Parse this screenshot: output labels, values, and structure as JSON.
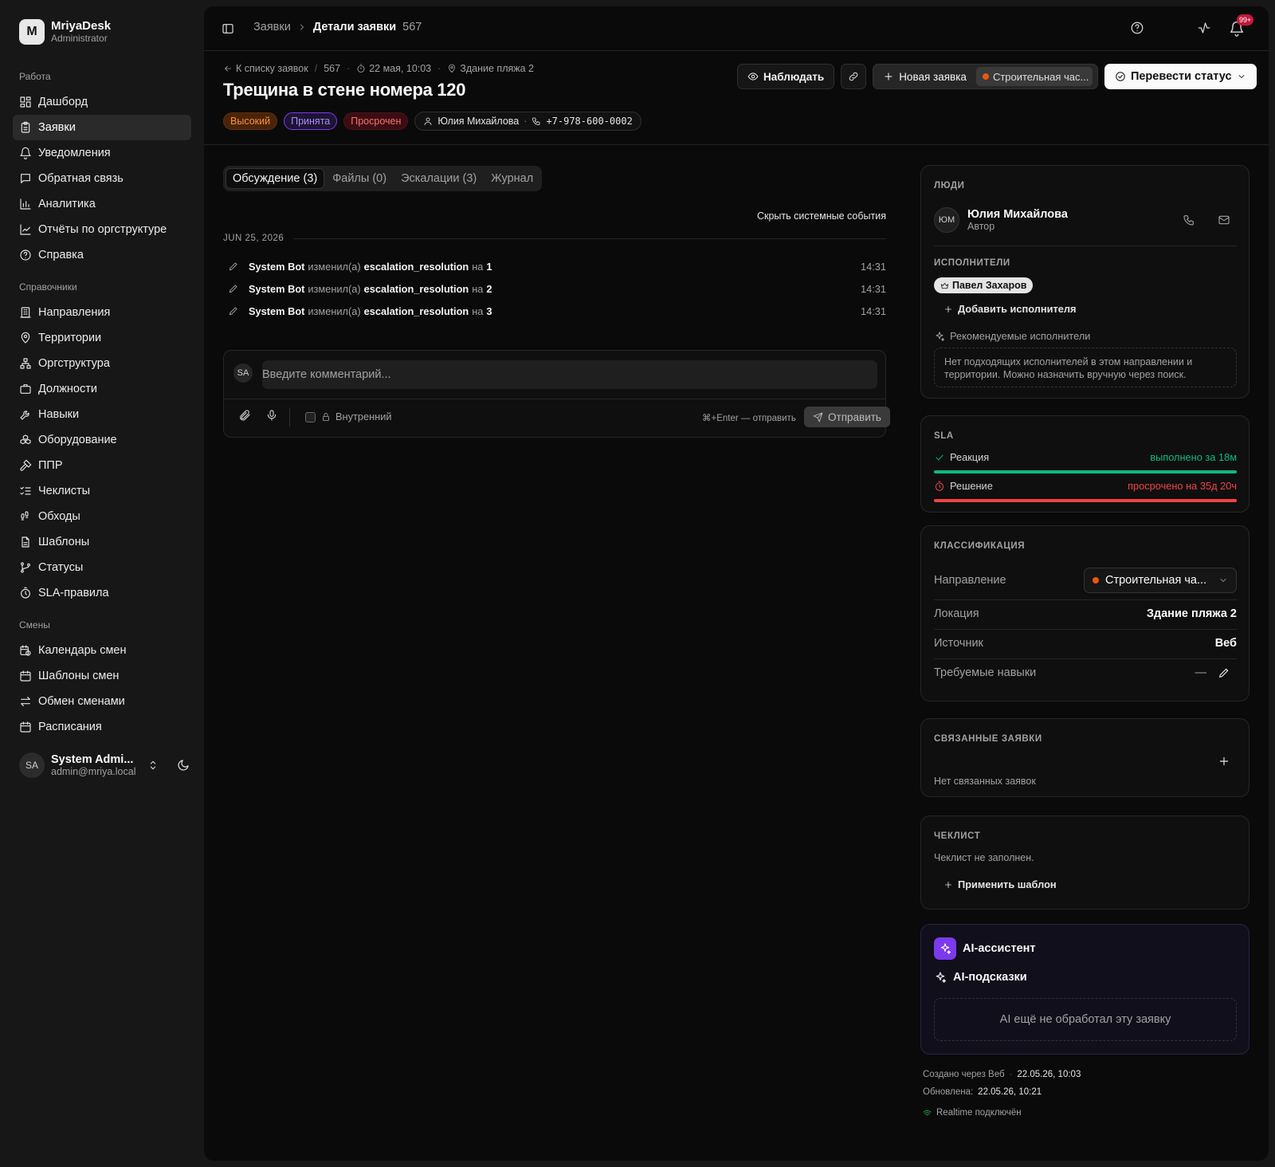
{
  "app": {
    "name": "MriyaDesk",
    "role": "Administrator",
    "logo_letter": "M"
  },
  "sidebar": {
    "groups": [
      {
        "title": "Работа",
        "items": [
          {
            "label": "Дашборд",
            "icon": "dashboard-icon"
          },
          {
            "label": "Заявки",
            "icon": "clipboard-icon",
            "active": true
          },
          {
            "label": "Уведомления",
            "icon": "bell-icon"
          },
          {
            "label": "Обратная связь",
            "icon": "message-icon"
          },
          {
            "label": "Аналитика",
            "icon": "bar-chart-icon"
          },
          {
            "label": "Отчёты по оргструктуре",
            "icon": "line-chart-icon"
          },
          {
            "label": "Справка",
            "icon": "help-icon"
          }
        ]
      },
      {
        "title": "Справочники",
        "items": [
          {
            "label": "Направления",
            "icon": "building-icon"
          },
          {
            "label": "Территории",
            "icon": "map-pin-icon"
          },
          {
            "label": "Оргструктура",
            "icon": "network-icon"
          },
          {
            "label": "Должности",
            "icon": "briefcase-icon"
          },
          {
            "label": "Навыки",
            "icon": "wrench-icon"
          },
          {
            "label": "Оборудование",
            "icon": "boxes-icon"
          },
          {
            "label": "ППР",
            "icon": "hammer-icon"
          },
          {
            "label": "Чеклисты",
            "icon": "list-checks-icon"
          },
          {
            "label": "Обходы",
            "icon": "footprints-icon"
          },
          {
            "label": "Шаблоны",
            "icon": "file-icon"
          },
          {
            "label": "Статусы",
            "icon": "git-branch-icon"
          },
          {
            "label": "SLA-правила",
            "icon": "timer-icon"
          }
        ]
      },
      {
        "title": "Смены",
        "items": [
          {
            "label": "Календарь смен",
            "icon": "calendar-clock-icon"
          },
          {
            "label": "Шаблоны смен",
            "icon": "calendar-icon"
          },
          {
            "label": "Обмен сменами",
            "icon": "swap-icon"
          },
          {
            "label": "Расписания",
            "icon": "calendar-icon"
          }
        ]
      }
    ],
    "user": {
      "initials": "SA",
      "name": "System Admi...",
      "email": "admin@mriya.local"
    }
  },
  "topbar": {
    "crumbs": [
      "Заявки",
      "Детали заявки",
      "567"
    ],
    "bell_badge": "99+"
  },
  "ticket": {
    "back_label": "К списку заявок",
    "number": "567",
    "created": "22 мая, 10:03",
    "location": "Здание пляжа 2",
    "title": "Трещина в стене номера 120",
    "tags": {
      "priority": "Высокий",
      "status": "Принята",
      "overdue": "Просрочен"
    },
    "contact": {
      "name": "Юлия Михайлова",
      "phone": "+7-978-600-0002"
    },
    "actions": {
      "watch": "Наблюдать",
      "new": "Новая заявка",
      "new_chip": "Строительная час...",
      "status": "Перевести статус"
    }
  },
  "tabs": [
    "Обсуждение (3)",
    "Файлы (0)",
    "Эскалации (3)",
    "Журнал"
  ],
  "feed": {
    "filter_label": "Скрыть системные события",
    "date": "JUN 25, 2026",
    "events": [
      {
        "actor": "System Bot",
        "verb": "изменил(а)",
        "field": "escalation_resolution",
        "prep": "на",
        "value": "1",
        "time": "14:31"
      },
      {
        "actor": "System Bot",
        "verb": "изменил(а)",
        "field": "escalation_resolution",
        "prep": "на",
        "value": "2",
        "time": "14:31"
      },
      {
        "actor": "System Bot",
        "verb": "изменил(а)",
        "field": "escalation_resolution",
        "prep": "на",
        "value": "3",
        "time": "14:31"
      }
    ]
  },
  "composer": {
    "initials": "SA",
    "placeholder": "Введите комментарий...",
    "internal_label": "Внутренний",
    "hint": "⌘+Enter — отправить",
    "send_label": "Отправить"
  },
  "people": {
    "title": "ЛЮДИ",
    "author": {
      "initials": "ЮМ",
      "name": "Юлия Михайлова",
      "role": "Автор"
    },
    "assignees_title": "ИСПОЛНИТЕЛИ",
    "assignee": "Павел Захаров",
    "add_label": "Добавить исполнителя",
    "rec_label": "Рекомендуемые исполнители",
    "rec_empty": "Нет подходящих исполнителей в этом направлении и территории. Можно назначить вручную через поиск."
  },
  "sla": {
    "title": "SLA",
    "reaction": {
      "label": "Реакция",
      "status": "выполнено за 18м",
      "progress": 1.0,
      "color": "#10b981"
    },
    "resolution": {
      "label": "Решение",
      "status": "просрочено на 35д 20ч",
      "progress": 1.0,
      "color": "#ef4444"
    }
  },
  "classification": {
    "title": "КЛАССИФИКАЦИЯ",
    "rows": {
      "direction": {
        "label": "Направление",
        "value": "Строительная ча..."
      },
      "location": {
        "label": "Локация",
        "value": "Здание пляжа 2"
      },
      "source": {
        "label": "Источник",
        "value": "Веб"
      },
      "skills": {
        "label": "Требуемые навыки",
        "value": "—"
      }
    }
  },
  "linked": {
    "title": "СВЯЗАННЫЕ ЗАЯВКИ",
    "empty": "Нет связанных заявок"
  },
  "checklist": {
    "title": "ЧЕКЛИСТ",
    "empty": "Чеклист не заполнен.",
    "apply": "Применить шаблон"
  },
  "ai": {
    "title": "AI-ассистент",
    "subtitle": "AI-подсказки",
    "empty": "AI ещё не обработал эту заявку"
  },
  "footer": {
    "created_label": "Создано через Веб",
    "created_at": "22.05.26, 10:03",
    "updated_label": "Обновлена:",
    "updated_at": "22.05.26, 10:21",
    "realtime": "Realtime подключён"
  },
  "colors": {
    "accent_orange": "#ea580c",
    "accent_purple": "#7c3aed",
    "success": "#10b981",
    "danger": "#ef4444"
  }
}
